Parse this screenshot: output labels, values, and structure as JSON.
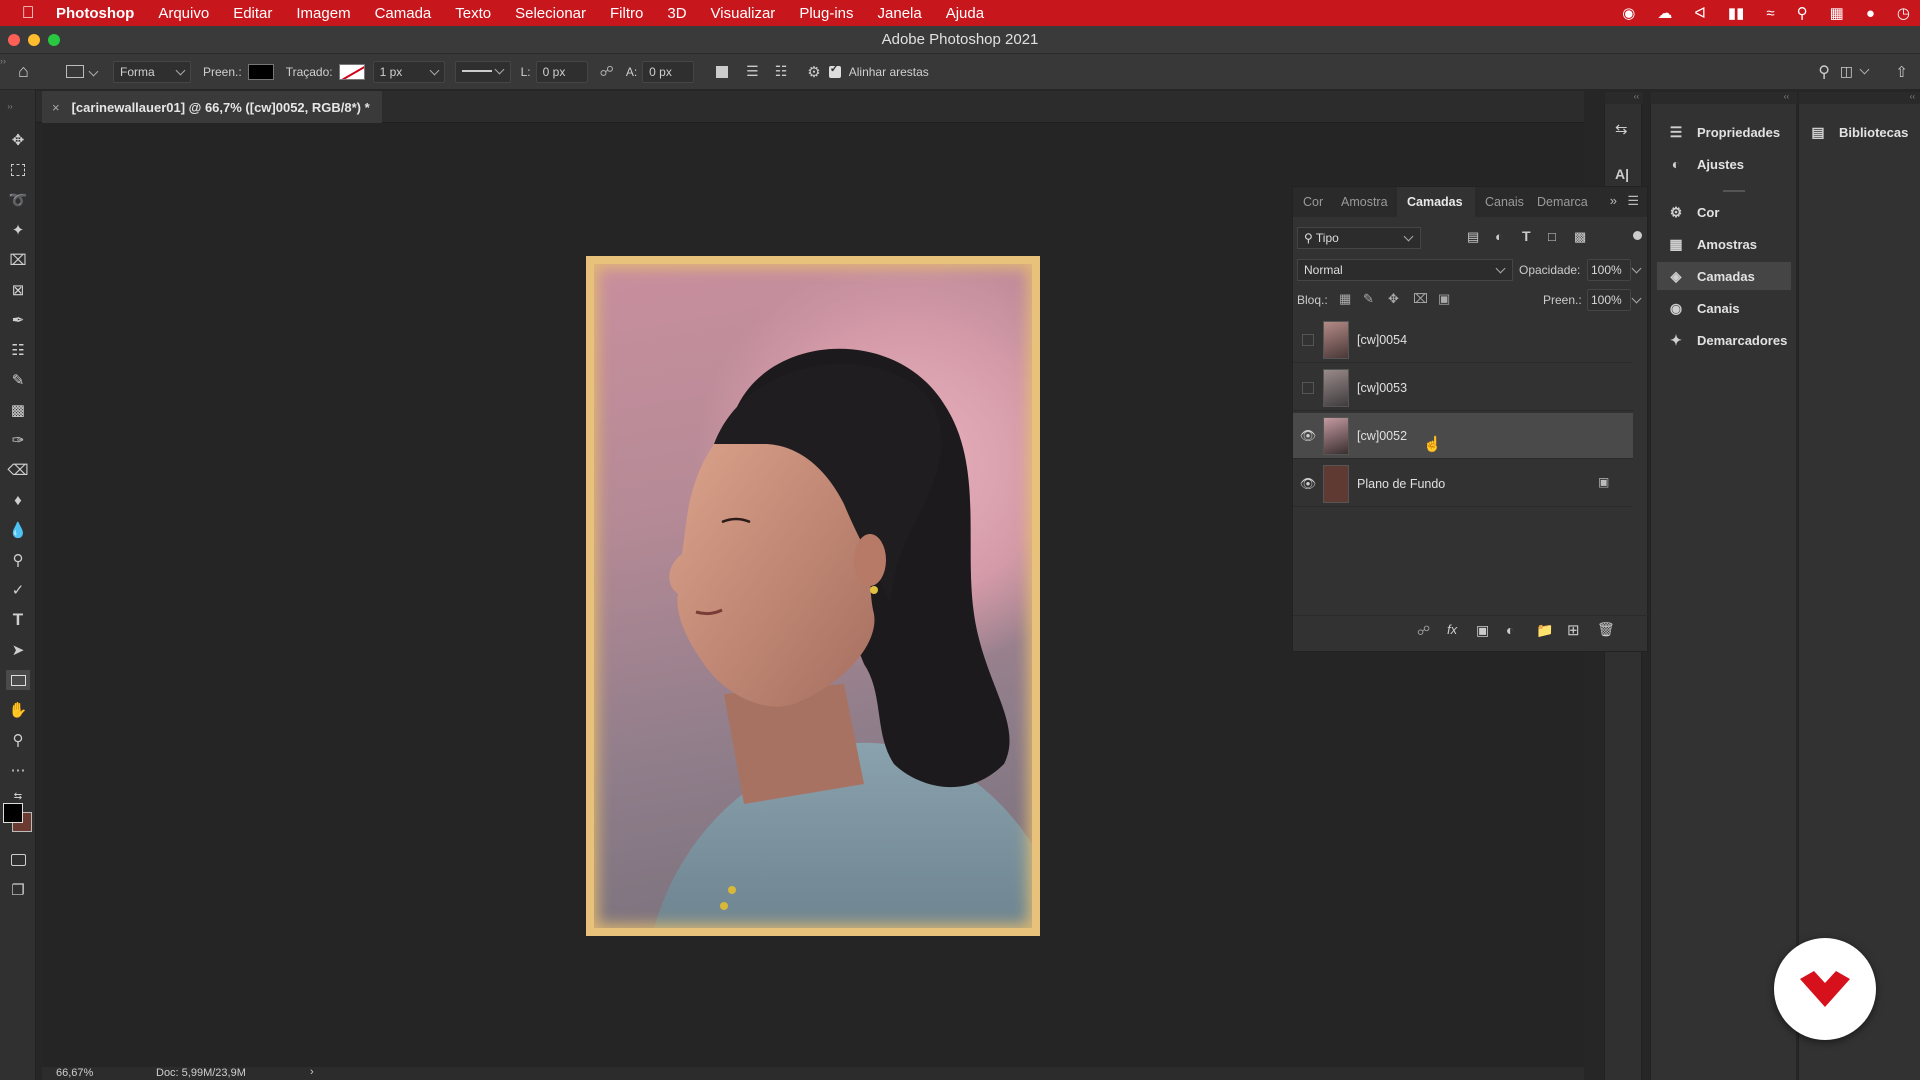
{
  "menubar": {
    "app_name": "Photoshop",
    "items": [
      "Arquivo",
      "Editar",
      "Imagem",
      "Camada",
      "Texto",
      "Selecionar",
      "Filtro",
      "3D",
      "Visualizar",
      "Plug-ins",
      "Janela",
      "Ajuda"
    ]
  },
  "window": {
    "title": "Adobe Photoshop 2021"
  },
  "options": {
    "shape_mode": "Forma",
    "fill_label": "Preen.:",
    "stroke_label": "Traçado:",
    "stroke_width": "1 px",
    "width_label": "L:",
    "width_value": "0 px",
    "height_label": "A:",
    "height_value": "0 px",
    "align_edges_label": "Alinhar arestas"
  },
  "document": {
    "tab_title": "[carinewallauer01] @ 66,7% ([cw]0052, RGB/8*) *",
    "zoom": "66,67%",
    "doc_info": "Doc: 5,99M/23,9M"
  },
  "layers_panel": {
    "tabs": [
      "Cor",
      "Amostra",
      "Camadas",
      "Canais",
      "Demarca"
    ],
    "active_tab": "Camadas",
    "filter_kind": "Tipo",
    "blend_mode": "Normal",
    "opacity_label": "Opacidade:",
    "opacity_value": "100%",
    "lock_label": "Bloq.:",
    "fill_label": "Preen.:",
    "fill_value": "100%",
    "layers": [
      {
        "name": "[cw]0054",
        "visible": false,
        "selected": false
      },
      {
        "name": "[cw]0053",
        "visible": false,
        "selected": false
      },
      {
        "name": "[cw]0052",
        "visible": true,
        "selected": true
      },
      {
        "name": "Plano de Fundo",
        "visible": true,
        "selected": false,
        "locked": true
      }
    ]
  },
  "dock": {
    "items": [
      "Propriedades",
      "Ajustes",
      "Cor",
      "Amostras",
      "Camadas",
      "Canais",
      "Demarcadores"
    ],
    "active": "Camadas",
    "libraries": "Bibliotecas"
  },
  "colors": {
    "menubar": "#c8161d",
    "foreground": "#000000",
    "background": "#6b3a30",
    "logo": "#d6111c"
  }
}
